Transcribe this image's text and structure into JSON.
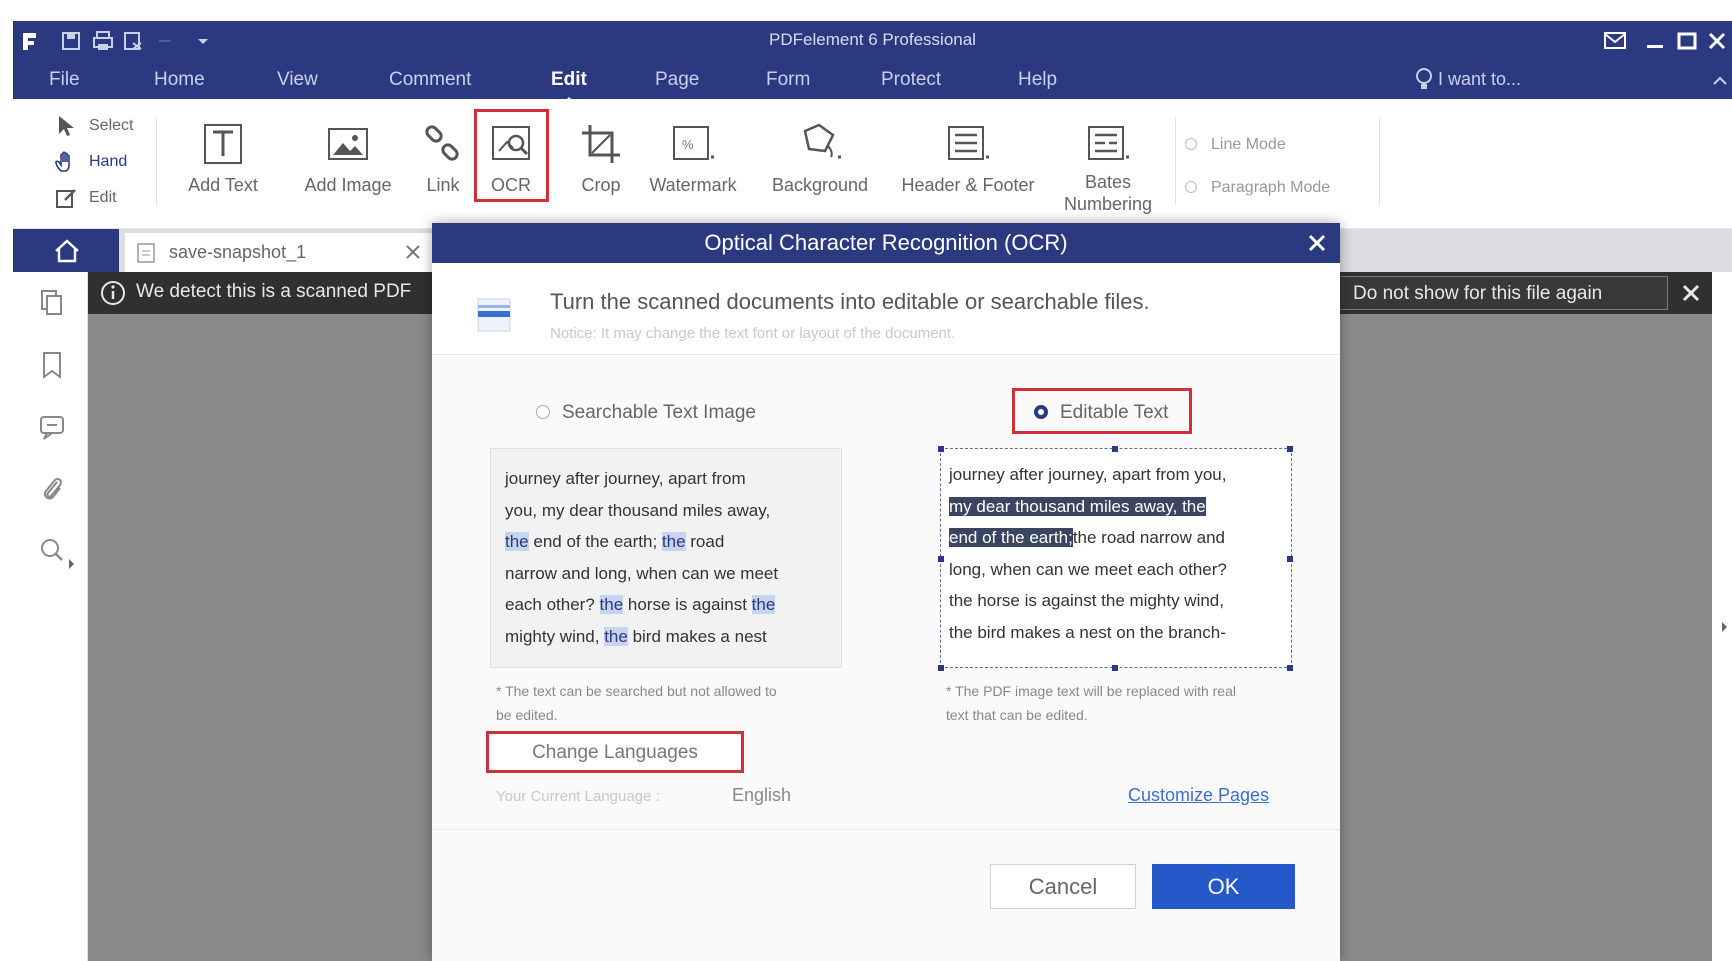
{
  "app": {
    "title": "PDFelement 6 Professional",
    "accent_color": "#2b3a80"
  },
  "menu": {
    "items": [
      {
        "label": "File"
      },
      {
        "label": "Home"
      },
      {
        "label": "View"
      },
      {
        "label": "Comment"
      },
      {
        "label": "Edit",
        "active": true
      },
      {
        "label": "Page"
      },
      {
        "label": "Form"
      },
      {
        "label": "Protect"
      },
      {
        "label": "Help"
      }
    ],
    "search_label": "I want to..."
  },
  "ribbon": {
    "modes": [
      {
        "label": "Select",
        "icon": "cursor-icon"
      },
      {
        "label": "Hand",
        "icon": "hand-icon"
      },
      {
        "label": "Edit",
        "icon": "edit-icon"
      }
    ],
    "tools": [
      {
        "label": "Add Text",
        "icon": "add-text-icon"
      },
      {
        "label": "Add Image",
        "icon": "add-image-icon"
      },
      {
        "label": "Link",
        "icon": "link-icon"
      },
      {
        "label": "OCR",
        "icon": "ocr-icon",
        "highlighted": true
      },
      {
        "label": "Crop",
        "icon": "crop-icon"
      },
      {
        "label": "Watermark",
        "icon": "watermark-icon"
      },
      {
        "label": "Background",
        "icon": "background-icon"
      },
      {
        "label": "Header & Footer",
        "icon": "header-footer-icon"
      },
      {
        "label": "Bates Numbering",
        "icon": "bates-numbering-icon"
      }
    ],
    "line_mode": "Line Mode",
    "paragraph_mode": "Paragraph Mode"
  },
  "tabs": {
    "document_tab": "save-snapshot_1"
  },
  "notice": {
    "text": "We detect this is a scanned PDF",
    "dismiss_label": "Do not show for this file again"
  },
  "dialog": {
    "title": "Optical Character Recognition (OCR)",
    "headline": "Turn the scanned documents into editable or searchable files.",
    "subline": "Notice: It may change the text font or layout of the document.",
    "option_searchable": "Searchable Text Image",
    "option_editable": "Editable Text",
    "selected_option": "Editable Text",
    "preview_left_lines": [
      [
        "journey after journey, apart from"
      ],
      [
        "you, my dear thousand miles away,"
      ],
      [
        {
          "hl": "the"
        },
        " end of the earth; ",
        {
          "hl": "the"
        },
        " road"
      ],
      [
        "narrow and long, when can we meet"
      ],
      [
        "each other? ",
        {
          "hl": "the"
        },
        " horse is against ",
        {
          "hl": "the"
        }
      ],
      [
        "mighty wind, ",
        {
          "hl": "the"
        },
        " bird makes a nest"
      ]
    ],
    "preview_right_lines": [
      [
        "journey after journey, apart from you,"
      ],
      [
        {
          "sel": "my dear thousand miles away, the"
        }
      ],
      [
        {
          "sel": "end of the earth;"
        },
        "the road narrow and"
      ],
      [
        "long, when can we meet each other?"
      ],
      [
        "the horse is against the mighty wind,"
      ],
      [
        "the bird makes a nest on the branch-"
      ]
    ],
    "note_searchable": "* The text can be searched but not allowed to be edited.",
    "note_editable": "* The PDF image text will be replaced with real text that can be edited.",
    "change_languages_label": "Change Languages",
    "current_language_label": "Your Current Language :",
    "current_language_value": "English",
    "customize_pages_label": "Customize Pages",
    "cancel_label": "Cancel",
    "ok_label": "OK",
    "ok_color": "#2559c9"
  }
}
